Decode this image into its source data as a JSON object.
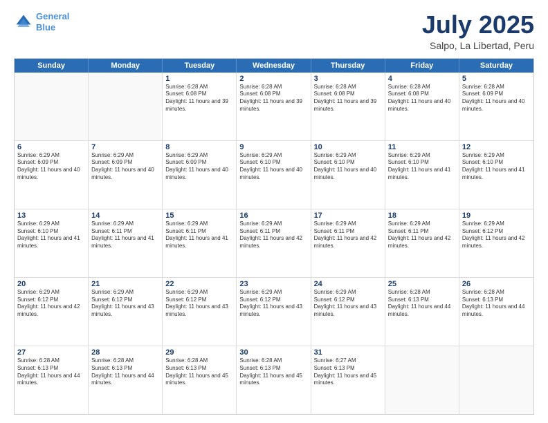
{
  "header": {
    "logo_line1": "General",
    "logo_line2": "Blue",
    "month_year": "July 2025",
    "location": "Salpo, La Libertad, Peru"
  },
  "weekdays": [
    "Sunday",
    "Monday",
    "Tuesday",
    "Wednesday",
    "Thursday",
    "Friday",
    "Saturday"
  ],
  "rows": [
    [
      {
        "day": "",
        "text": ""
      },
      {
        "day": "",
        "text": ""
      },
      {
        "day": "1",
        "text": "Sunrise: 6:28 AM\nSunset: 6:08 PM\nDaylight: 11 hours and 39 minutes."
      },
      {
        "day": "2",
        "text": "Sunrise: 6:28 AM\nSunset: 6:08 PM\nDaylight: 11 hours and 39 minutes."
      },
      {
        "day": "3",
        "text": "Sunrise: 6:28 AM\nSunset: 6:08 PM\nDaylight: 11 hours and 39 minutes."
      },
      {
        "day": "4",
        "text": "Sunrise: 6:28 AM\nSunset: 6:08 PM\nDaylight: 11 hours and 40 minutes."
      },
      {
        "day": "5",
        "text": "Sunrise: 6:28 AM\nSunset: 6:09 PM\nDaylight: 11 hours and 40 minutes."
      }
    ],
    [
      {
        "day": "6",
        "text": "Sunrise: 6:29 AM\nSunset: 6:09 PM\nDaylight: 11 hours and 40 minutes."
      },
      {
        "day": "7",
        "text": "Sunrise: 6:29 AM\nSunset: 6:09 PM\nDaylight: 11 hours and 40 minutes."
      },
      {
        "day": "8",
        "text": "Sunrise: 6:29 AM\nSunset: 6:09 PM\nDaylight: 11 hours and 40 minutes."
      },
      {
        "day": "9",
        "text": "Sunrise: 6:29 AM\nSunset: 6:10 PM\nDaylight: 11 hours and 40 minutes."
      },
      {
        "day": "10",
        "text": "Sunrise: 6:29 AM\nSunset: 6:10 PM\nDaylight: 11 hours and 40 minutes."
      },
      {
        "day": "11",
        "text": "Sunrise: 6:29 AM\nSunset: 6:10 PM\nDaylight: 11 hours and 41 minutes."
      },
      {
        "day": "12",
        "text": "Sunrise: 6:29 AM\nSunset: 6:10 PM\nDaylight: 11 hours and 41 minutes."
      }
    ],
    [
      {
        "day": "13",
        "text": "Sunrise: 6:29 AM\nSunset: 6:10 PM\nDaylight: 11 hours and 41 minutes."
      },
      {
        "day": "14",
        "text": "Sunrise: 6:29 AM\nSunset: 6:11 PM\nDaylight: 11 hours and 41 minutes."
      },
      {
        "day": "15",
        "text": "Sunrise: 6:29 AM\nSunset: 6:11 PM\nDaylight: 11 hours and 41 minutes."
      },
      {
        "day": "16",
        "text": "Sunrise: 6:29 AM\nSunset: 6:11 PM\nDaylight: 11 hours and 42 minutes."
      },
      {
        "day": "17",
        "text": "Sunrise: 6:29 AM\nSunset: 6:11 PM\nDaylight: 11 hours and 42 minutes."
      },
      {
        "day": "18",
        "text": "Sunrise: 6:29 AM\nSunset: 6:11 PM\nDaylight: 11 hours and 42 minutes."
      },
      {
        "day": "19",
        "text": "Sunrise: 6:29 AM\nSunset: 6:12 PM\nDaylight: 11 hours and 42 minutes."
      }
    ],
    [
      {
        "day": "20",
        "text": "Sunrise: 6:29 AM\nSunset: 6:12 PM\nDaylight: 11 hours and 42 minutes."
      },
      {
        "day": "21",
        "text": "Sunrise: 6:29 AM\nSunset: 6:12 PM\nDaylight: 11 hours and 43 minutes."
      },
      {
        "day": "22",
        "text": "Sunrise: 6:29 AM\nSunset: 6:12 PM\nDaylight: 11 hours and 43 minutes."
      },
      {
        "day": "23",
        "text": "Sunrise: 6:29 AM\nSunset: 6:12 PM\nDaylight: 11 hours and 43 minutes."
      },
      {
        "day": "24",
        "text": "Sunrise: 6:29 AM\nSunset: 6:12 PM\nDaylight: 11 hours and 43 minutes."
      },
      {
        "day": "25",
        "text": "Sunrise: 6:28 AM\nSunset: 6:13 PM\nDaylight: 11 hours and 44 minutes."
      },
      {
        "day": "26",
        "text": "Sunrise: 6:28 AM\nSunset: 6:13 PM\nDaylight: 11 hours and 44 minutes."
      }
    ],
    [
      {
        "day": "27",
        "text": "Sunrise: 6:28 AM\nSunset: 6:13 PM\nDaylight: 11 hours and 44 minutes."
      },
      {
        "day": "28",
        "text": "Sunrise: 6:28 AM\nSunset: 6:13 PM\nDaylight: 11 hours and 44 minutes."
      },
      {
        "day": "29",
        "text": "Sunrise: 6:28 AM\nSunset: 6:13 PM\nDaylight: 11 hours and 45 minutes."
      },
      {
        "day": "30",
        "text": "Sunrise: 6:28 AM\nSunset: 6:13 PM\nDaylight: 11 hours and 45 minutes."
      },
      {
        "day": "31",
        "text": "Sunrise: 6:27 AM\nSunset: 6:13 PM\nDaylight: 11 hours and 45 minutes."
      },
      {
        "day": "",
        "text": ""
      },
      {
        "day": "",
        "text": ""
      }
    ]
  ]
}
